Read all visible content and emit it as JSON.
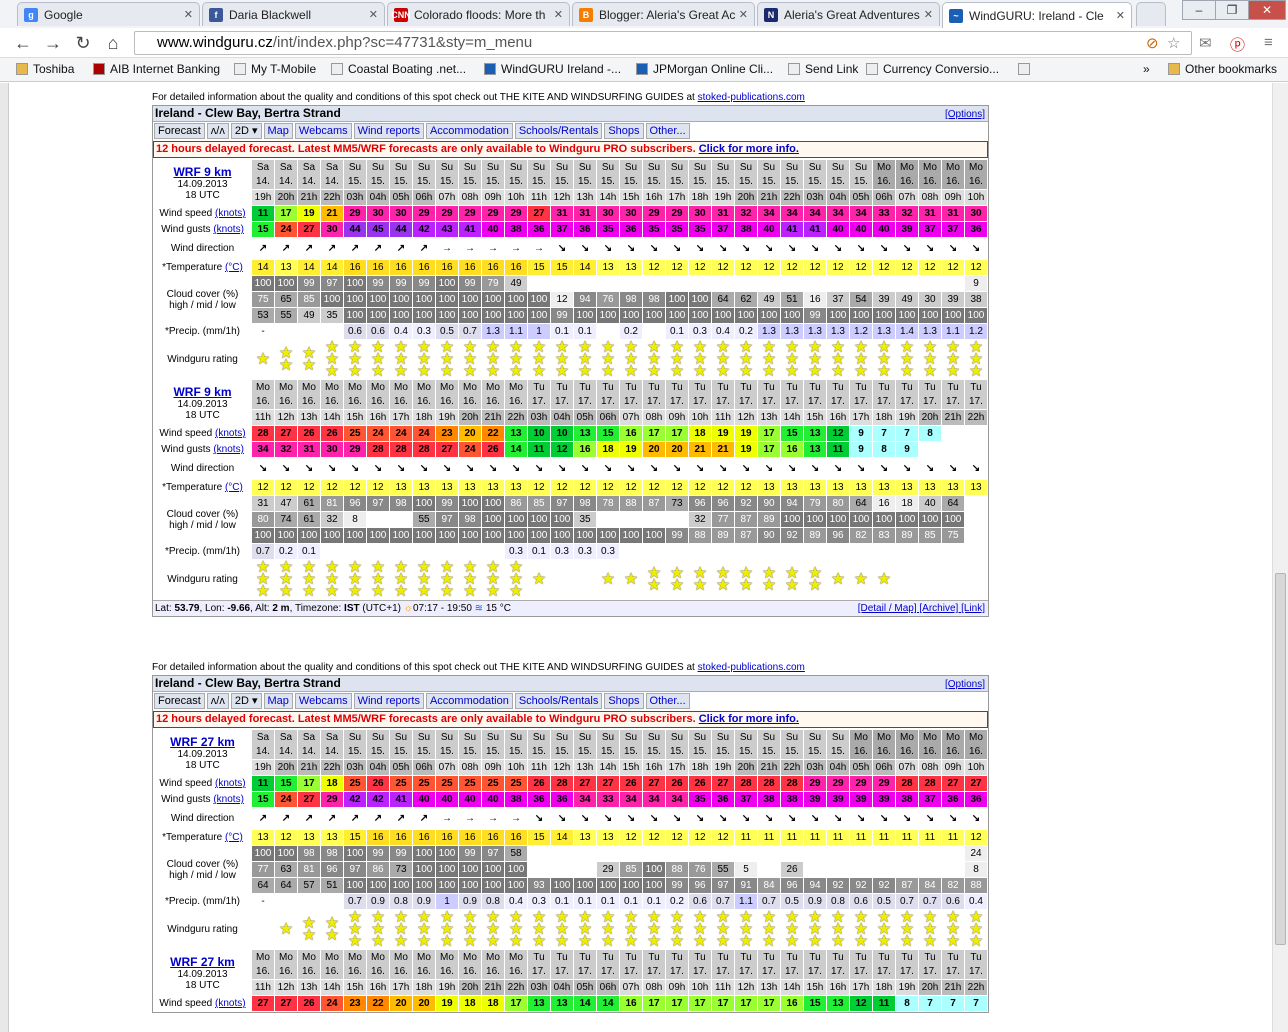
{
  "tabs": [
    {
      "title": "Google",
      "icon": "google-favicon",
      "color": "#4285f4",
      "glyph": "g"
    },
    {
      "title": "Daria Blackwell",
      "icon": "facebook-favicon",
      "color": "#3b5998",
      "glyph": "f"
    },
    {
      "title": "Colorado floods: More th",
      "icon": "cnn-favicon",
      "color": "#c00",
      "glyph": "CNN"
    },
    {
      "title": "Blogger: Aleria's Great Ac",
      "icon": "blogger-favicon",
      "color": "#f57d00",
      "glyph": "B"
    },
    {
      "title": "Aleria's Great Adventures",
      "icon": "blog-favicon",
      "color": "#1a2a6c",
      "glyph": "N"
    },
    {
      "title": "WindGURU: Ireland - Cle",
      "icon": "windguru-favicon",
      "color": "#1a5fb4",
      "glyph": "~"
    }
  ],
  "url": {
    "domain": "www.windguru.cz",
    "path": "/int/index.php?sc=47731&sty=m_menu"
  },
  "bookmarks": [
    "Toshiba",
    "AIB Internet Banking",
    "My T-Mobile",
    "Coastal Boating .net...",
    "WindGURU Ireland -...",
    "JPMorgan Online Cli...",
    "Send Link",
    "Currency Conversio...",
    "",
    "»",
    "Other bookmarks"
  ],
  "info_text": "For detailed information about the quality and conditions of this spot check out THE KITE AND WINDSURFING GUIDES at ",
  "info_link": "stoked-publications.com",
  "spot_title": "Ireland - Clew Bay, Bertra Strand",
  "options_label": "[Options]",
  "menu": [
    "Forecast",
    "ʌ/ʌ",
    "2D ▾",
    "Map",
    "Webcams",
    "Wind reports",
    "Accommodation",
    "Schools/Rentals",
    "Shops",
    "Other..."
  ],
  "delayed_text": "12 hours delayed forecast. Latest MM5/WRF forecasts are only available to Windguru PRO subscribers. ",
  "delayed_link": "Click for more info.",
  "labels": {
    "wind_speed": "Wind speed",
    "wind_gusts": "Wind gusts",
    "knots": "(knots)",
    "wind_direction": "Wind direction",
    "temperature": "*Temperature",
    "celsius": "(°C)",
    "cloud1": "Cloud cover (%)",
    "cloud2": "high / mid / low",
    "precip": "*Precip. (mm/1h)",
    "rating": "Windguru rating"
  },
  "bottom_line": {
    "lat_label": "Lat: ",
    "lat": "53.79",
    "lon_label": ", Lon: ",
    "lon": "-9.66",
    "alt_label": ", Alt: ",
    "alt": "2 m",
    "tz_label": ", Timezone: ",
    "tz": "IST",
    "tz_off": " (UTC+1) ",
    "sun": "07:17 - 19:50",
    "water": " 15 °C",
    "links": "[Detail / Map] [Archive] [Link]"
  },
  "blocks": [
    {
      "model": "WRF 9 km",
      "date": "14.09.2013",
      "utc": "18 UTC",
      "days": [
        "Sa 14.",
        "Sa 14.",
        "Sa 14.",
        "Sa 14.",
        "Su 15.",
        "Su 15.",
        "Su 15.",
        "Su 15.",
        "Su 15.",
        "Su 15.",
        "Su 15.",
        "Su 15.",
        "Su 15.",
        "Su 15.",
        "Su 15.",
        "Su 15.",
        "Su 15.",
        "Su 15.",
        "Su 15.",
        "Su 15.",
        "Su 15.",
        "Su 15.",
        "Su 15.",
        "Su 15.",
        "Su 15.",
        "Su 15.",
        "Su 15.",
        "Mo 16.",
        "Mo 16.",
        "Mo 16.",
        "Mo 16.",
        "Mo 16.",
        "Mo 16.",
        "Mo 16."
      ],
      "hours": [
        "19h",
        "20h",
        "21h",
        "22h",
        "03h",
        "04h",
        "05h",
        "06h",
        "07h",
        "08h",
        "09h",
        "10h",
        "11h",
        "12h",
        "13h",
        "14h",
        "15h",
        "16h",
        "17h",
        "18h",
        "19h",
        "20h",
        "21h",
        "22h",
        "03h",
        "04h",
        "05h",
        "06h",
        "07h",
        "08h",
        "09h",
        "10h"
      ],
      "speed": [
        11,
        17,
        19,
        21,
        29,
        30,
        30,
        29,
        29,
        29,
        29,
        29,
        27,
        31,
        31,
        30,
        30,
        29,
        29,
        30,
        31,
        32,
        34,
        34,
        34,
        34,
        34,
        33,
        32,
        31,
        31,
        30
      ],
      "gusts": [
        15,
        24,
        27,
        30,
        44,
        45,
        44,
        42,
        43,
        41,
        40,
        38,
        36,
        37,
        36,
        35,
        36,
        35,
        35,
        35,
        37,
        38,
        40,
        41,
        41,
        40,
        40,
        40,
        39,
        37,
        37,
        36
      ],
      "dir": [
        "↗",
        "↗",
        "↗",
        "↗",
        "↗",
        "↗",
        "↗",
        "↗",
        "→",
        "→",
        "→",
        "→",
        "→",
        "↘",
        "↘",
        "↘",
        "↘",
        "↘",
        "↘",
        "↘",
        "↘",
        "↘",
        "↘",
        "↘",
        "↘",
        "↘",
        "↘",
        "↘",
        "↘",
        "↘",
        "↘",
        "↘"
      ],
      "temp": [
        14,
        13,
        14,
        14,
        16,
        16,
        16,
        16,
        16,
        16,
        16,
        16,
        15,
        15,
        14,
        13,
        13,
        12,
        12,
        12,
        12,
        12,
        12,
        12,
        12,
        12,
        12,
        12,
        12,
        12,
        12,
        12
      ],
      "high": [
        "100",
        "100",
        "99",
        "97",
        "100",
        "99",
        "99",
        "99",
        "100",
        "99",
        "79",
        "49",
        "",
        "",
        "",
        "",
        "",
        "",
        "",
        "",
        "",
        "",
        "",
        "",
        "",
        "",
        "",
        "",
        "",
        "",
        "",
        "9"
      ],
      "mid": [
        "75",
        "65",
        "85",
        "100",
        "100",
        "100",
        "100",
        "100",
        "100",
        "100",
        "100",
        "100",
        "100",
        "12",
        "94",
        "76",
        "98",
        "98",
        "100",
        "100",
        "64",
        "62",
        "49",
        "51",
        "16",
        "37",
        "54",
        "39",
        "49",
        "30",
        "39",
        "38"
      ],
      "low": [
        "53",
        "55",
        "49",
        "35",
        "100",
        "100",
        "100",
        "100",
        "100",
        "100",
        "100",
        "100",
        "100",
        "99",
        "100",
        "100",
        "100",
        "100",
        "100",
        "100",
        "100",
        "100",
        "100",
        "100",
        "99",
        "100",
        "100",
        "100",
        "100",
        "100",
        "100",
        "100"
      ],
      "precip": [
        "-",
        "",
        "",
        "",
        "0.6",
        "0.6",
        "0.4",
        "0.3",
        "0.5",
        "0.7",
        "1.3",
        "1.1",
        "1",
        "0.1",
        "0.1",
        "",
        "0.2",
        "",
        "0.1",
        "0.3",
        "0.4",
        "0.2",
        "1.3",
        "1.3",
        "1.3",
        "1.3",
        "1.2",
        "1.3",
        "1.4",
        "1.3",
        "1.1",
        "1.2"
      ],
      "stars": [
        1,
        2,
        2,
        3,
        3,
        3,
        3,
        3,
        3,
        3,
        3,
        3,
        3,
        3,
        3,
        3,
        3,
        3,
        3,
        3,
        3,
        3,
        3,
        3,
        3,
        3,
        3,
        3,
        3,
        3,
        3,
        3
      ]
    },
    {
      "model": "WRF 9 km",
      "date": "14.09.2013",
      "utc": "18 UTC",
      "days": [
        "Mo 16.",
        "Mo 16.",
        "Mo 16.",
        "Mo 16.",
        "Mo 16.",
        "Mo 16.",
        "Mo 16.",
        "Mo 16.",
        "Mo 16.",
        "Mo 16.",
        "Mo 16.",
        "Mo 16.",
        "Tu 17.",
        "Tu 17.",
        "Tu 17.",
        "Tu 17.",
        "Tu 17.",
        "Tu 17.",
        "Tu 17.",
        "Tu 17.",
        "Tu 17.",
        "Tu 17.",
        "Tu 17.",
        "Tu 17.",
        "Tu 17.",
        "Tu 17.",
        "Tu 17.",
        "Tu 17.",
        "Tu 17.",
        "Tu 17.",
        "Tu 17.",
        "Tu 17."
      ],
      "hours": [
        "11h",
        "12h",
        "13h",
        "14h",
        "15h",
        "16h",
        "17h",
        "18h",
        "19h",
        "20h",
        "21h",
        "22h",
        "03h",
        "04h",
        "05h",
        "06h",
        "07h",
        "08h",
        "09h",
        "10h",
        "11h",
        "12h",
        "13h",
        "14h",
        "15h",
        "16h",
        "17h",
        "18h",
        "19h",
        "20h",
        "21h",
        "22h"
      ],
      "speed": [
        28,
        27,
        26,
        26,
        25,
        24,
        24,
        24,
        23,
        20,
        22,
        13,
        10,
        10,
        13,
        15,
        16,
        17,
        17,
        18,
        19,
        19,
        17,
        15,
        13,
        12,
        9,
        7,
        7,
        8,
        "",
        ""
      ],
      "gusts": [
        34,
        32,
        31,
        30,
        29,
        28,
        28,
        28,
        27,
        24,
        26,
        14,
        11,
        12,
        16,
        18,
        19,
        20,
        20,
        21,
        21,
        19,
        17,
        16,
        13,
        11,
        9,
        8,
        9,
        "",
        "",
        ""
      ],
      "dir": [
        "↘",
        "↘",
        "↘",
        "↘",
        "↘",
        "↘",
        "↘",
        "↘",
        "↘",
        "↘",
        "↘",
        "↘",
        "↘",
        "↘",
        "↘",
        "↘",
        "↘",
        "↘",
        "↘",
        "↘",
        "↘",
        "↘",
        "↘",
        "↘",
        "↘",
        "↘",
        "↘",
        "↘",
        "↘",
        "↘",
        "↘",
        "↘"
      ],
      "temp": [
        12,
        12,
        12,
        12,
        12,
        12,
        13,
        13,
        13,
        13,
        13,
        13,
        12,
        12,
        12,
        12,
        12,
        12,
        12,
        12,
        12,
        12,
        13,
        13,
        13,
        13,
        13,
        13,
        13,
        13,
        13,
        13
      ],
      "high": [
        "31",
        "47",
        "61",
        "81",
        "96",
        "97",
        "98",
        "100",
        "99",
        "100",
        "100",
        "86",
        "85",
        "97",
        "98",
        "78",
        "88",
        "87",
        "73",
        "96",
        "96",
        "92",
        "90",
        "94",
        "79",
        "80",
        "64",
        "16",
        "18",
        "40",
        "64",
        ""
      ],
      "mid": [
        "80",
        "74",
        "61",
        "32",
        "8",
        "",
        "",
        "55",
        "97",
        "98",
        "100",
        "100",
        "100",
        "100",
        "35",
        "",
        "",
        "",
        "",
        "32",
        "77",
        "87",
        "89",
        "100",
        "100",
        "100",
        "100",
        "100",
        "100",
        "100",
        "100",
        ""
      ],
      "low": [
        "100",
        "100",
        "100",
        "100",
        "100",
        "100",
        "100",
        "100",
        "100",
        "100",
        "100",
        "100",
        "100",
        "100",
        "100",
        "100",
        "100",
        "100",
        "99",
        "88",
        "89",
        "87",
        "90",
        "92",
        "89",
        "96",
        "82",
        "83",
        "89",
        "85",
        "75",
        ""
      ],
      "precip": [
        "0.7",
        "0.2",
        "0.1",
        "",
        "",
        "",
        "",
        "",
        "",
        "",
        "",
        "0.3",
        "0.1",
        "0.3",
        "0.3",
        "0.3",
        "",
        "",
        "",
        "",
        "",
        "",
        "",
        "",
        "",
        "",
        "",
        "",
        "",
        "",
        "",
        ""
      ],
      "stars": [
        3,
        3,
        3,
        3,
        3,
        3,
        3,
        3,
        3,
        3,
        3,
        3,
        1,
        0,
        0,
        1,
        1,
        2,
        2,
        2,
        2,
        2,
        2,
        2,
        2,
        1,
        1,
        1,
        0,
        0,
        0,
        0
      ]
    },
    {
      "model": "WRF 27 km",
      "date": "14.09.2013",
      "utc": "18 UTC",
      "days": [
        "Sa 14.",
        "Sa 14.",
        "Sa 14.",
        "Sa 14.",
        "Su 15.",
        "Su 15.",
        "Su 15.",
        "Su 15.",
        "Su 15.",
        "Su 15.",
        "Su 15.",
        "Su 15.",
        "Su 15.",
        "Su 15.",
        "Su 15.",
        "Su 15.",
        "Su 15.",
        "Su 15.",
        "Su 15.",
        "Su 15.",
        "Su 15.",
        "Su 15.",
        "Su 15.",
        "Su 15.",
        "Su 15.",
        "Su 15.",
        "Mo 16.",
        "Mo 16.",
        "Mo 16.",
        "Mo 16.",
        "Mo 16.",
        "Mo 16."
      ],
      "hours": [
        "19h",
        "20h",
        "21h",
        "22h",
        "03h",
        "04h",
        "05h",
        "06h",
        "07h",
        "08h",
        "09h",
        "10h",
        "11h",
        "12h",
        "13h",
        "14h",
        "15h",
        "16h",
        "17h",
        "18h",
        "19h",
        "20h",
        "21h",
        "22h",
        "03h",
        "04h",
        "05h",
        "06h",
        "07h",
        "08h",
        "09h",
        "10h"
      ],
      "speed": [
        11,
        15,
        17,
        18,
        25,
        26,
        25,
        25,
        25,
        25,
        25,
        25,
        26,
        28,
        27,
        27,
        26,
        27,
        26,
        26,
        27,
        28,
        28,
        28,
        29,
        29,
        29,
        29,
        28,
        28,
        27,
        27
      ],
      "gusts": [
        15,
        24,
        27,
        29,
        42,
        42,
        41,
        40,
        40,
        40,
        40,
        38,
        36,
        36,
        34,
        33,
        34,
        34,
        34,
        35,
        36,
        37,
        38,
        38,
        39,
        39,
        39,
        39,
        38,
        37,
        36,
        36
      ],
      "dir": [
        "↗",
        "↗",
        "↗",
        "↗",
        "↗",
        "↗",
        "↗",
        "↗",
        "→",
        "→",
        "→",
        "→",
        "↘",
        "↘",
        "↘",
        "↘",
        "↘",
        "↘",
        "↘",
        "↘",
        "↘",
        "↘",
        "↘",
        "↘",
        "↘",
        "↘",
        "↘",
        "↘",
        "↘",
        "↘",
        "↘",
        "↘"
      ],
      "temp": [
        13,
        12,
        13,
        13,
        15,
        16,
        16,
        16,
        16,
        16,
        16,
        16,
        15,
        14,
        13,
        13,
        12,
        12,
        12,
        12,
        12,
        11,
        11,
        11,
        11,
        11,
        11,
        11,
        11,
        11,
        11,
        12
      ],
      "high": [
        "100",
        "100",
        "98",
        "98",
        "100",
        "99",
        "99",
        "100",
        "100",
        "99",
        "97",
        "58",
        "",
        "",
        "",
        "",
        "",
        "",
        "",
        "",
        "",
        "",
        "",
        "",
        "",
        "",
        "",
        "",
        "",
        "",
        "",
        "24"
      ],
      "mid": [
        "77",
        "63",
        "81",
        "96",
        "97",
        "86",
        "73",
        "100",
        "100",
        "100",
        "100",
        "100",
        "",
        "",
        "",
        "29",
        "85",
        "100",
        "88",
        "76",
        "55",
        "5",
        "",
        "26",
        "",
        "",
        "",
        "",
        "",
        "",
        "",
        "8"
      ],
      "low": [
        "64",
        "64",
        "57",
        "51",
        "100",
        "100",
        "100",
        "100",
        "100",
        "100",
        "100",
        "100",
        "93",
        "100",
        "100",
        "100",
        "100",
        "100",
        "99",
        "96",
        "97",
        "91",
        "84",
        "96",
        "94",
        "92",
        "92",
        "92",
        "87",
        "84",
        "82",
        "88"
      ],
      "precip": [
        "-",
        "",
        "",
        "",
        "0.7",
        "0.9",
        "0.8",
        "0.9",
        "1",
        "0.9",
        "0.8",
        "0.4",
        "0.3",
        "0.1",
        "0.1",
        "0.1",
        "0.1",
        "0.1",
        "0.2",
        "0.6",
        "0.7",
        "1.1",
        "0.7",
        "0.5",
        "0.9",
        "0.8",
        "0.6",
        "0.5",
        "0.7",
        "0.7",
        "0.6",
        "0.4"
      ],
      "stars": [
        0,
        1,
        2,
        2,
        3,
        3,
        3,
        3,
        3,
        3,
        3,
        3,
        3,
        3,
        3,
        3,
        3,
        3,
        3,
        3,
        3,
        3,
        3,
        3,
        3,
        3,
        3,
        3,
        3,
        3,
        3,
        3
      ]
    },
    {
      "model": "WRF 27 km",
      "date": "14.09.2013",
      "utc": "18 UTC",
      "days": [
        "Mo 16.",
        "Mo 16.",
        "Mo 16.",
        "Mo 16.",
        "Mo 16.",
        "Mo 16.",
        "Mo 16.",
        "Mo 16.",
        "Mo 16.",
        "Mo 16.",
        "Mo 16.",
        "Mo 16.",
        "Tu 17.",
        "Tu 17.",
        "Tu 17.",
        "Tu 17.",
        "Tu 17.",
        "Tu 17.",
        "Tu 17.",
        "Tu 17.",
        "Tu 17.",
        "Tu 17.",
        "Tu 17.",
        "Tu 17.",
        "Tu 17.",
        "Tu 17.",
        "Tu 17.",
        "Tu 17.",
        "Tu 17.",
        "Tu 17.",
        "Tu 17.",
        "Tu 17."
      ],
      "hours": [
        "11h",
        "12h",
        "13h",
        "14h",
        "15h",
        "16h",
        "17h",
        "18h",
        "19h",
        "20h",
        "21h",
        "22h",
        "03h",
        "04h",
        "05h",
        "06h",
        "07h",
        "08h",
        "09h",
        "10h",
        "11h",
        "12h",
        "13h",
        "14h",
        "15h",
        "16h",
        "17h",
        "18h",
        "19h",
        "20h",
        "21h",
        "22h"
      ],
      "speed": [
        27,
        27,
        26,
        24,
        23,
        22,
        20,
        20,
        19,
        18,
        18,
        17,
        13,
        13,
        14,
        14,
        16,
        17,
        17,
        17,
        17,
        17,
        17,
        16,
        15,
        13,
        12,
        11,
        8,
        7,
        7,
        7
      ]
    }
  ]
}
